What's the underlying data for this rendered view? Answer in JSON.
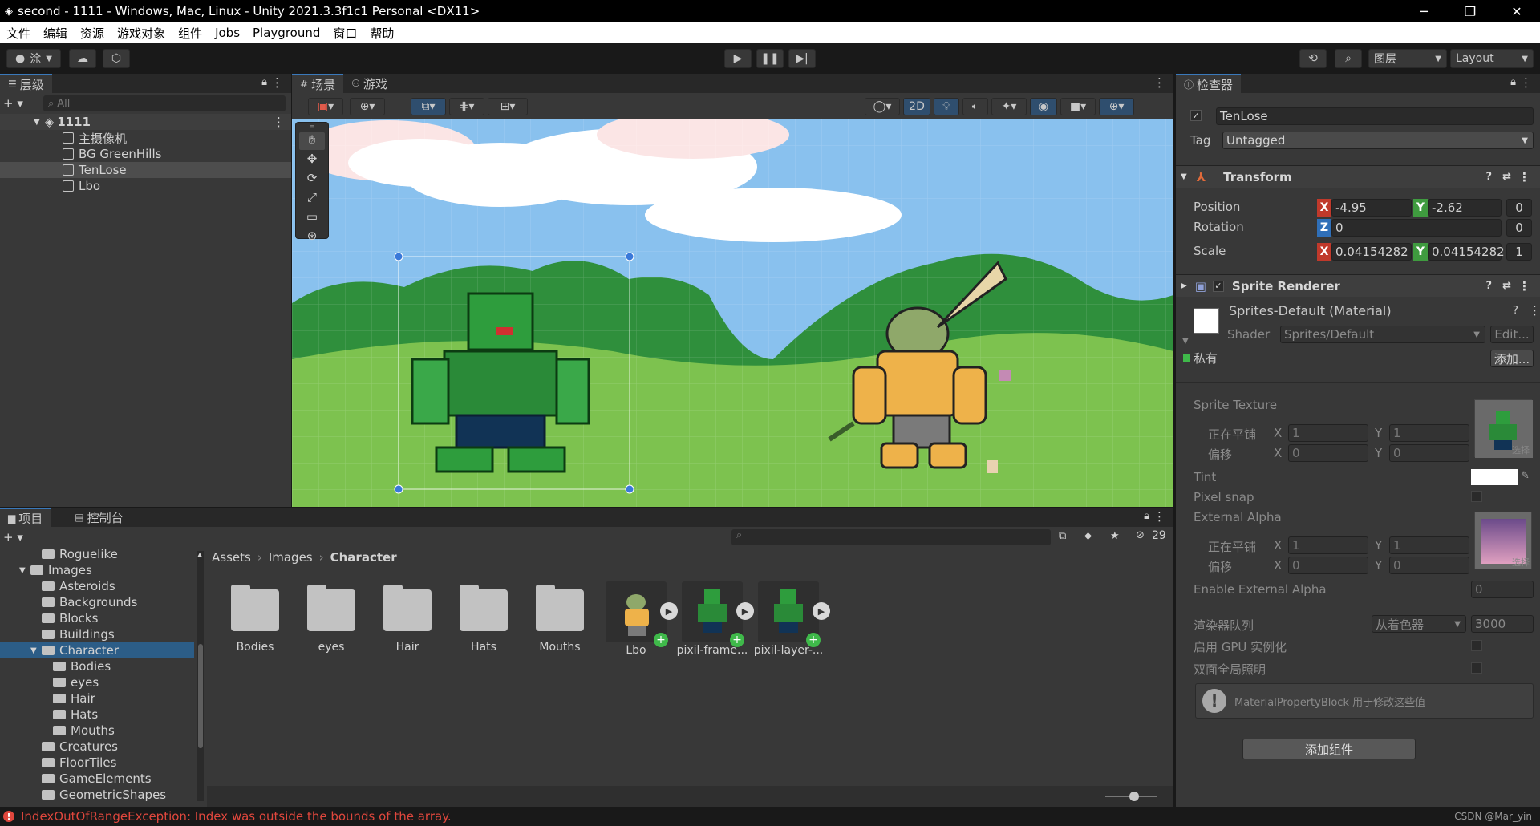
{
  "window": {
    "title": "second - 1111 - Windows, Mac, Linux - Unity 2021.3.3f1c1 Personal <DX11>",
    "minimize": "─",
    "restore": "❐",
    "close": "✕"
  },
  "menu": [
    "文件",
    "编辑",
    "资源",
    "游戏对象",
    "组件",
    "Jobs",
    "Playground",
    "窗口",
    "帮助"
  ],
  "toolbar": {
    "account_label": "涂",
    "layers_label": "图层",
    "layout_label": "Layout"
  },
  "hierarchy": {
    "tab_label": "层级",
    "search_placeholder": "All",
    "scene_name": "1111",
    "items": [
      "主摄像机",
      "BG GreenHills",
      "TenLose",
      "Lbo"
    ]
  },
  "scene_tabs": [
    "场景",
    "游戏"
  ],
  "scene_toolbar": {
    "mode_2d": "2D"
  },
  "project": {
    "tabs": [
      "项目",
      "控制台"
    ],
    "tree": [
      {
        "label": "Roguelike",
        "depth": 2
      },
      {
        "label": "Images",
        "depth": 1,
        "expanded": true
      },
      {
        "label": "Asteroids",
        "depth": 2
      },
      {
        "label": "Backgrounds",
        "depth": 2
      },
      {
        "label": "Blocks",
        "depth": 2
      },
      {
        "label": "Buildings",
        "depth": 2
      },
      {
        "label": "Character",
        "depth": 2,
        "expanded": true,
        "selected": true
      },
      {
        "label": "Bodies",
        "depth": 3
      },
      {
        "label": "eyes",
        "depth": 3
      },
      {
        "label": "Hair",
        "depth": 3
      },
      {
        "label": "Hats",
        "depth": 3
      },
      {
        "label": "Mouths",
        "depth": 3
      },
      {
        "label": "Creatures",
        "depth": 2
      },
      {
        "label": "FloorTiles",
        "depth": 2
      },
      {
        "label": "GameElements",
        "depth": 2
      },
      {
        "label": "GeometricShapes",
        "depth": 2
      }
    ],
    "breadcrumb": [
      "Assets",
      "Images",
      "Character"
    ],
    "hidden_count": "29",
    "assets": [
      {
        "label": "Bodies",
        "kind": "folder"
      },
      {
        "label": "eyes",
        "kind": "folder"
      },
      {
        "label": "Hair",
        "kind": "folder"
      },
      {
        "label": "Hats",
        "kind": "folder"
      },
      {
        "label": "Mouths",
        "kind": "folder"
      },
      {
        "label": "Lbo",
        "kind": "prefab-yellow"
      },
      {
        "label": "pixil-frame...",
        "kind": "prefab-green"
      },
      {
        "label": "pixil-layer-...",
        "kind": "prefab-green"
      }
    ]
  },
  "inspector": {
    "tab_label": "检查器",
    "object_name": "TenLose",
    "tag_label": "Tag",
    "tag_value": "Untagged",
    "transform": {
      "title": "Transform",
      "position_label": "Position",
      "rotation_label": "Rotation",
      "scale_label": "Scale",
      "pos_x": "-4.95",
      "pos_y": "-2.62",
      "pos_z": "0",
      "rot_z": "0",
      "rot_extra": "0",
      "scale_x": "0.04154282",
      "scale_y": "0.04154282",
      "scale_z": "1"
    },
    "sprite_renderer": {
      "title": "Sprite Renderer",
      "material": "Sprites-Default (Material)",
      "shader_label": "Shader",
      "shader_value": "Sprites/Default",
      "edit_label": "Edit...",
      "private_label": "私有",
      "add_label": "添加...",
      "sprite_texture": "Sprite Texture",
      "tiling_label": "正在平铺",
      "offset_label": "偏移",
      "tiling_x": "1",
      "tiling_y": "1",
      "offset_x": "0",
      "offset_y": "0",
      "select_label": "选择",
      "tint_label": "Tint",
      "pixel_snap": "Pixel snap",
      "external_alpha": "External Alpha",
      "ext_tiling_x": "1",
      "ext_tiling_y": "1",
      "ext_offset_x": "0",
      "ext_offset_y": "0",
      "enable_external_alpha": "Enable External Alpha",
      "enable_external_alpha_value": "0",
      "render_queue_label": "渲染器队列",
      "render_queue_mode": "从着色器",
      "render_queue_value": "3000",
      "gpu_instancing": "启用 GPU 实例化",
      "double_sided_gi": "双面全局照明",
      "info_message": "MaterialPropertyBlock 用于修改这些值"
    },
    "add_component": "添加组件"
  },
  "status": {
    "error": "IndexOutOfRangeException: Index was outside the bounds of the array.",
    "watermark": "CSDN @Mar_yin"
  },
  "colors": {
    "accent": "#3a79bb",
    "error": "#e0473d",
    "selection": "#2c5d87",
    "sky": "#89c1ee",
    "grass": "#5aa03c"
  }
}
